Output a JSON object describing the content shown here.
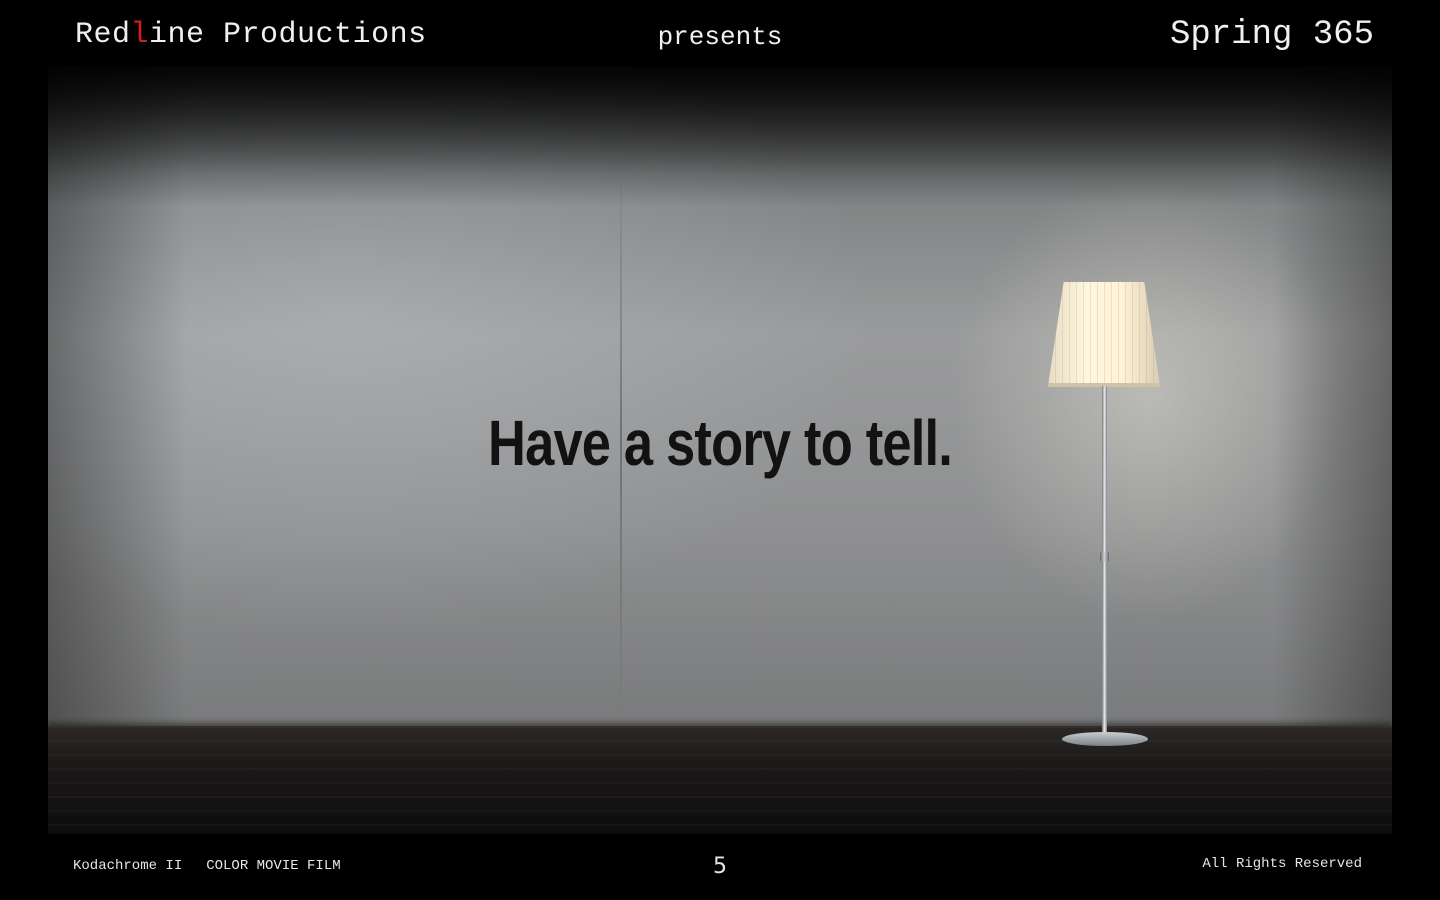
{
  "header": {
    "brand_part1": "Red",
    "brand_part2": "l",
    "brand_part3": "ine Productions",
    "presents": "presents",
    "season": "Spring 365"
  },
  "slide": {
    "headline": "Have a story to tell."
  },
  "footer": {
    "film_stock": "Kodachrome II",
    "film_type": "COLOR MOVIE FILM",
    "page_number": "5",
    "rights": "All Rights Reserved"
  },
  "colors": {
    "background": "#000000",
    "accent_red": "#d01f1f",
    "text_light": "#f0f0f0",
    "headline": "#121212"
  },
  "icons": [
    "floor-lamp"
  ]
}
